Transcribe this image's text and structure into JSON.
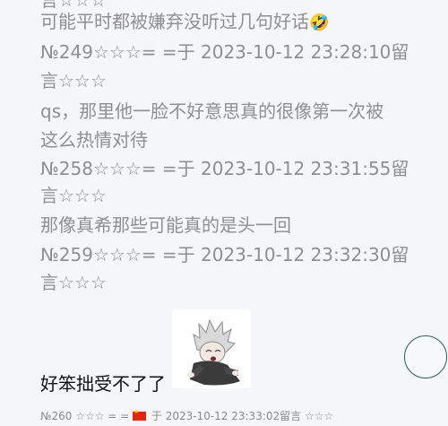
{
  "messages": [
    {
      "text": "言☆☆☆"
    },
    {
      "text": "可能平时都被嫌弃没听过几句好话"
    },
    {
      "text": "№249☆☆☆= =于 2023-10-12 23:28:10留"
    },
    {
      "text": "言☆☆☆"
    },
    {
      "text": "qs，那里他一脸不好意思真的很像第一次被"
    },
    {
      "text": "这么热情对待"
    },
    {
      "text": "№258☆☆☆= =于 2023-10-12 23:31:55留"
    },
    {
      "text": "言☆☆☆"
    },
    {
      "text": "那像真希那些可能真的是头一回"
    },
    {
      "text": "№259☆☆☆= =于 2023-10-12 23:32:30留"
    },
    {
      "text": "言☆☆☆"
    }
  ],
  "emoji": "🤣",
  "reply": {
    "text": "好笨拙受不了了"
  },
  "footer": {
    "prefix": "№260 ☆☆☆ = =",
    "suffix": "于 2023-10-12 23:33:02留言 ☆☆☆"
  },
  "colors": {
    "text_gray": "#8f8f8f",
    "background": "#f5f6f8",
    "fab_border": "#2e5b56",
    "flag_red": "#de2910"
  }
}
